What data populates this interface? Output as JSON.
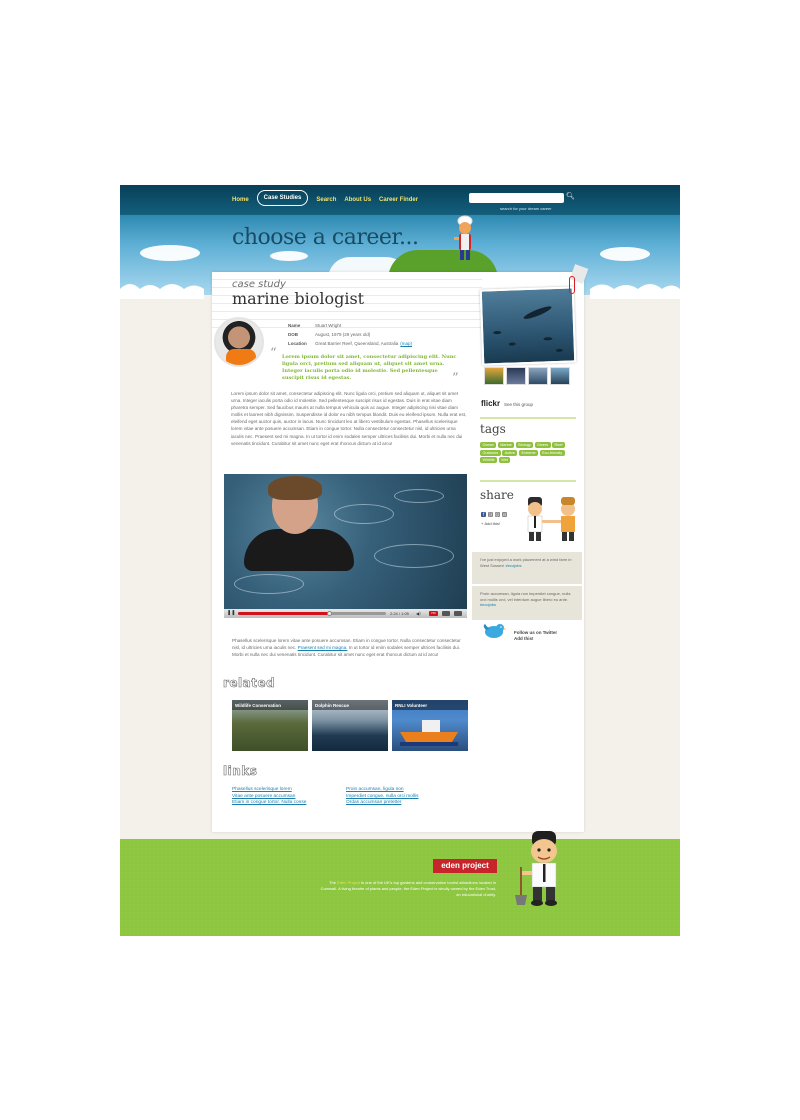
{
  "nav": {
    "items": [
      {
        "label": "Home",
        "active": false
      },
      {
        "label": "Case Studies",
        "active": true
      },
      {
        "label": "Search",
        "active": false
      },
      {
        "label": "About Us",
        "active": false
      },
      {
        "label": "Career Finder",
        "active": false
      }
    ]
  },
  "search": {
    "placeholder": "",
    "caption": "search for your dream career"
  },
  "header": {
    "headline": "choose a career..."
  },
  "case": {
    "eyebrow": "case study",
    "title": "marine biologist",
    "details": [
      {
        "label": "Name",
        "value": "Stuart Wright"
      },
      {
        "label": "DOB",
        "value": "August, 1979 (29 years old)"
      },
      {
        "label": "Location",
        "value": "Great Barrier Reef, Queensland, Australia"
      }
    ],
    "map_link": "(map)",
    "quote": "Lorem ipsum dolor sit amet, consectetur adipiscing elit. Nunc ligula orci, pretium sed aliquam ut, aliquet sit amet urna. Integer iaculis porta odio id molestie. Sed pellentesque suscipit risus id egestas.",
    "body1": "Lorem ipsum dolor sit amet, consectetur adipiscing elit. Nunc ligula orci, pretium sed aliquam ut, aliquet sit amet urna. Integer iaculis porta odio id molestie. Sed pellentesque suscipit risus id egestas. Duis in erat vitae diam pharetra semper. Sed faucibus mauris at nulla tempus vehicula quis ac augue. Integer adipiscing nisi vitae diam mollis et laoreet nibh dignissim. Suspendisse id dolor eu nibh tempus blandit. Duis eu eleifend ipsum. Nulla erat est, eleifend eget auctor quis, auctor in lacus. Nunc tincidunt leo at libero vestibulum egestas. Phasellus scelerisque lorem vitae ante posuere accumsan. Etiam in congue tortor. Nulla consectetur consectetur nisl, id ultricies urna iaculis nec. Praesent sed mi magna. In ut tortor id enim sodales semper ultrices facilisis dui. Morbi et nulla nec dui venenatis tincidunt. Curabitur sit amet nunc eget erat rhoncus dictum at id arcu!",
    "body2_a": "Phasellus scelerisque lorem vitae ante posuere accumsan. Etiam in congue tortor. Nulla consectetur consectetur nisl, id ultricies urna iaculis nec.",
    "body2_link": "Praesent sed mi magna.",
    "body2_b": "In ut tortor id enim sodales semper ultrices facilisis dui. Morbi et nulla nec dui venenatis tincidunt. Curabitur sit amet nunc eget erat rhoncus dictum at id arcu!"
  },
  "video": {
    "time": "2:24 / 1:05",
    "hd": "HD",
    "progress": 0.62
  },
  "flickr": {
    "logo": "flickr",
    "group_link": "See this group"
  },
  "tags": {
    "title": "tags",
    "items": [
      "Ocean",
      "Marine",
      "Biology",
      "Divers",
      "Reef",
      "Outdoors",
      "Active",
      "Extreme",
      "Eco-friendly",
      "Wildlife",
      "Wet"
    ]
  },
  "share": {
    "title": "share",
    "add_this": "Add this!",
    "icons": [
      "f",
      "))",
      "☺",
      "⊟"
    ]
  },
  "tweets": [
    {
      "text": "I've just enjoyed a work placement at a wind farm in West Sussex!",
      "tag": "#ecojobs"
    },
    {
      "text": "Proin accumsan, ligula non imperdiet congue, nulla orci mollis orci, vel interdum augue libero eu ante.",
      "tag": "#ecojobs"
    }
  ],
  "twitter": {
    "line1": "Follow us on Twitter",
    "line2": "Add this!"
  },
  "related": {
    "title": "related",
    "items": [
      "Wildlife Conservation",
      "Dolphin Rescue",
      "RNLI Volunteer"
    ]
  },
  "links": {
    "title": "links",
    "col1": [
      "Phasellus scelerisque lorem",
      "Vitae ante posuere accumsan",
      "Etiam in congue tortor. Nulla conse"
    ],
    "col2": [
      "Proin accumsan, ligula non",
      "Imperdiet congue, nulla orci mollis",
      "Ordas accumsan pretetter"
    ]
  },
  "footer": {
    "logo": "eden project",
    "text_a": "The",
    "text_link": "Eden Project",
    "text_b": "is one of the UK's top gardens and conservation tourist attractions located in Cornwall. A living theatre of plants and people, the Eden Project is wholly owned by the Eden Trust, an educational charity."
  },
  "colors": {
    "accent": "#8dc63f",
    "header_dark": "#0d5a78",
    "link": "#1a7fae",
    "quote": "#7fb631",
    "eden_red": "#c6262b"
  }
}
